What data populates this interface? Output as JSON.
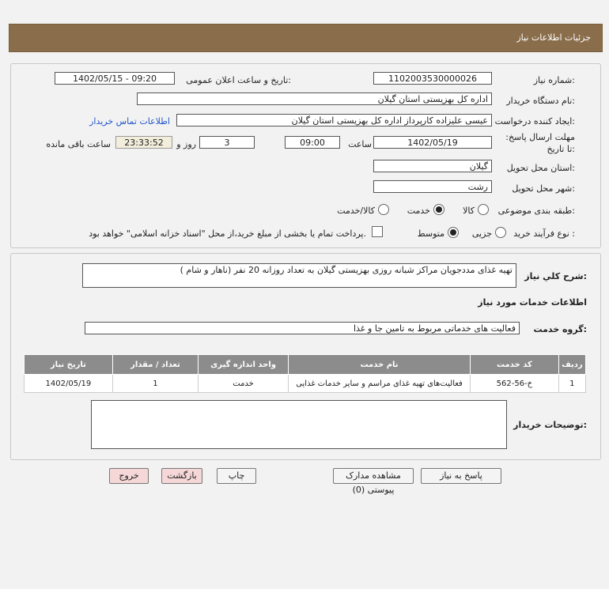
{
  "header": {
    "title": "جزئیات اطلاعات نیاز"
  },
  "fields": {
    "need_number_label": "شماره نیاز:",
    "need_number": "1102003530000026",
    "announce_label": "تاریخ و ساعت اعلان عمومی:",
    "announce_value": "1402/05/15 - 09:20",
    "buyer_org_label": "نام دستگاه خریدار:",
    "buyer_org": "اداره کل بهزیستی استان گیلان",
    "requester_label": "ایجاد کننده درخواست:",
    "requester": "عیسی علیزاده کارپرداز اداره کل بهزیستی استان گیلان",
    "contact_link": "اطلاعات تماس خریدار",
    "deadline_label": "مهلت ارسال پاسخ: تا تاریخ:",
    "deadline_date": "1402/05/19",
    "time_label": "ساعت",
    "deadline_time": "09:00",
    "days_value": "3",
    "days_label": "روز و",
    "remaining_time": "23:33:52",
    "remaining_label": "ساعت باقی مانده",
    "province_label": "استان محل تحویل:",
    "province": "گیلان",
    "city_label": "شهر محل تحویل:",
    "city": "رشت",
    "category_label": "طبقه بندی موضوعی:",
    "category_options": [
      "کالا",
      "خدمت",
      "کالا/خدمت"
    ],
    "category_selected": "خدمت",
    "process_label": "نوع فرآیند خرید :",
    "process_options": [
      "جزیی",
      "متوسط"
    ],
    "process_selected": "متوسط",
    "payment_note": "پرداخت تمام یا بخشی از مبلغ خرید،از محل \"اسناد خزانه اسلامی\" خواهد بود."
  },
  "summary": {
    "label": "شرح کلي نیاز:",
    "text": "تهیه غذای مددجویان مراکز شبانه روزی بهزیستی گیلان به تعداد روزانه 20 نفر  (ناهار و شام )"
  },
  "services": {
    "section_title": "اطلاعات خدمات مورد نیاز",
    "group_label": "گروه خدمت:",
    "group_value": "فعالیت های خدماتی مربوط به تامین جا و غذا",
    "columns": [
      "ردیف",
      "کد خدمت",
      "نام خدمت",
      "واحد اندازه گیری",
      "تعداد / مقدار",
      "تاریخ نیاز"
    ],
    "rows": [
      [
        "1",
        "خ-56-562",
        "فعالیت‌های تهیه غذای مراسم و سایر خدمات غذایی",
        "خدمت",
        "1",
        "1402/05/19"
      ]
    ]
  },
  "buyer_notes": {
    "label": "توضیحات خریدار:",
    "text": ""
  },
  "buttons": {
    "reply": "پاسخ به نیاز",
    "view_docs": "مشاهده مدارک پیوستی (0)",
    "print": "چاپ",
    "back": "بازگشت",
    "exit": "خروج"
  }
}
